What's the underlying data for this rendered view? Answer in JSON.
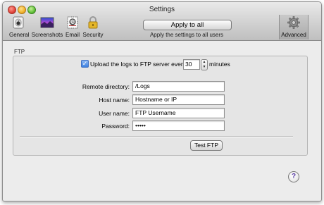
{
  "window": {
    "title": "Settings"
  },
  "toolbar": {
    "items": [
      {
        "label": "General",
        "icon": "apple-switch-icon"
      },
      {
        "label": "Screenshots",
        "icon": "screenshot-photo-icon"
      },
      {
        "label": "Email",
        "icon": "stamp-icon"
      },
      {
        "label": "Security",
        "icon": "padlock-icon"
      },
      {
        "label": "Advanced",
        "icon": "gear-icon"
      }
    ],
    "apply_label": "Apply to all",
    "apply_caption": "Apply the settings to all users"
  },
  "ftp": {
    "section_label": "FTP",
    "upload_checked": true,
    "upload_text_pre": "Upload the logs to FTP server every",
    "upload_minutes": "30",
    "upload_text_post": "minutes",
    "remote_directory_label": "Remote directory:",
    "remote_directory_value": "/Logs",
    "host_label": "Host name:",
    "host_value": "Hostname or IP",
    "user_label": "User name:",
    "user_value": "FTP Username",
    "password_label": "Password:",
    "password_value": "•••••",
    "test_label": "Test FTP"
  },
  "help": {
    "symbol": "?"
  }
}
